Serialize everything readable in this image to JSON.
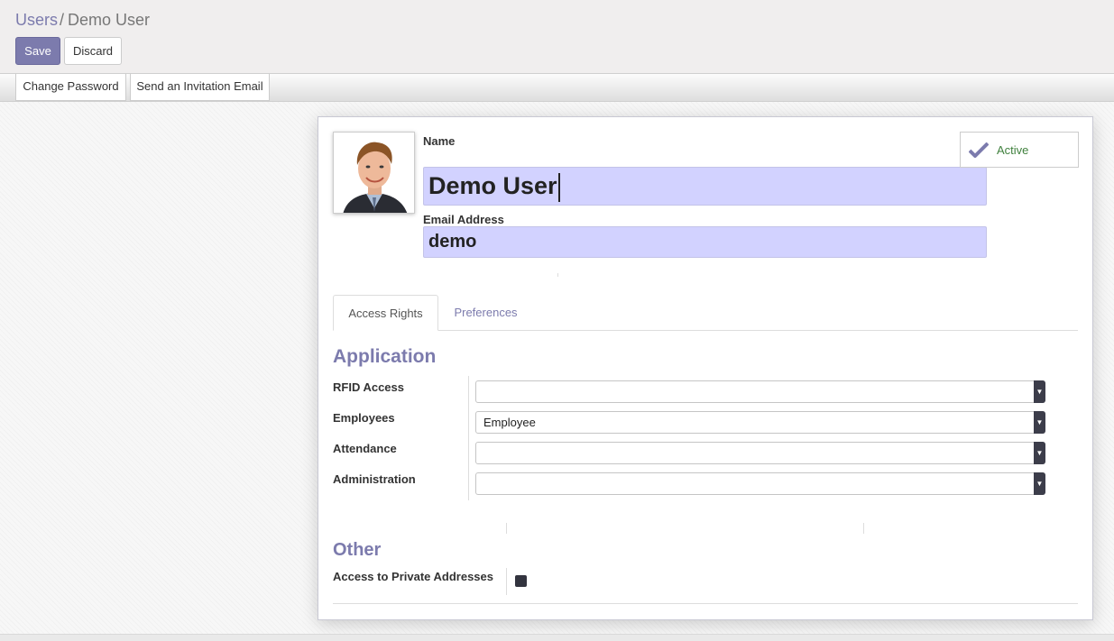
{
  "breadcrumb": {
    "parent": "Users",
    "separator": "/",
    "current": "Demo User"
  },
  "toolbar": {
    "save_label": "Save",
    "discard_label": "Discard"
  },
  "statusbar": {
    "change_password_label": "Change Password",
    "invite_label": "Send an Invitation Email"
  },
  "form": {
    "name_label": "Name",
    "name_value": "Demo User",
    "email_label": "Email Address",
    "email_value": "demo",
    "active_label": "Active",
    "active": true
  },
  "tabs": [
    {
      "label": "Access Rights",
      "active": true
    },
    {
      "label": "Preferences",
      "active": false
    }
  ],
  "application": {
    "title": "Application",
    "rows": [
      {
        "label": "RFID Access",
        "value": ""
      },
      {
        "label": "Employees",
        "value": "Employee"
      },
      {
        "label": "Attendance",
        "value": ""
      },
      {
        "label": "Administration",
        "value": ""
      }
    ]
  },
  "other": {
    "title": "Other",
    "private_addresses_label": "Access to Private Addresses",
    "private_addresses_checked": false
  },
  "colors": {
    "accent": "#7c7bad",
    "active_green": "#40813e",
    "field_highlight": "#d2d2ff"
  }
}
